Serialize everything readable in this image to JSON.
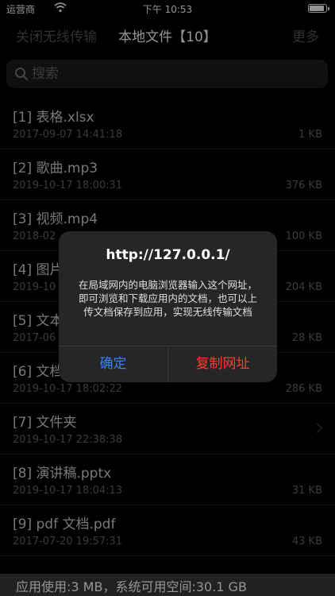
{
  "status_bar": {
    "carrier": "运营商",
    "time": "下午 10:53",
    "battery_level": 0.9
  },
  "nav": {
    "left": "关闭无线传输",
    "title": "本地文件【10】",
    "right": "更多"
  },
  "search": {
    "placeholder": "搜索"
  },
  "files": [
    {
      "name": "[1] 表格.xlsx",
      "date": "2017-09-07 14:41:18",
      "size": "1 KB"
    },
    {
      "name": "[2] 歌曲.mp3",
      "date": "2019-10-17 18:00:31",
      "size": "376 KB"
    },
    {
      "name": "[3] 视频.mp4",
      "date": "2018-02",
      "size": "100 KB"
    },
    {
      "name": "[4] 图片",
      "date": "2019-10",
      "size": "204 KB"
    },
    {
      "name": "[5] 文本",
      "date": "2017-06",
      "size": "28 KB"
    },
    {
      "name": "[6] 文档",
      "date": "2019-10-17 18:02:22",
      "size": "286 KB"
    },
    {
      "name": "[7] 文件夹",
      "date": "2019-10-17 22:38:38",
      "size": ""
    },
    {
      "name": "[8] 演讲稿.pptx",
      "date": "2019-10-17 18:04:13",
      "size": "31 KB"
    },
    {
      "name": "[9] pdf 文档.pdf",
      "date": "2017-07-20 19:57:31",
      "size": "43 KB"
    }
  ],
  "dialog": {
    "title": "http://127.0.0.1/",
    "message": "在局域网内的电脑浏览器输入这个网址，即可浏览和下载应用内的文档，也可以上传文档保存到应用，实现无线传输文档",
    "ok": "确定",
    "copy": "复制网址"
  },
  "footer": {
    "info": "应用使用:3 MB，系统可用空间:30.1 GB"
  },
  "colors": {
    "accent_blue": "#3b82f6",
    "destructive_red": "#ff3b30"
  }
}
